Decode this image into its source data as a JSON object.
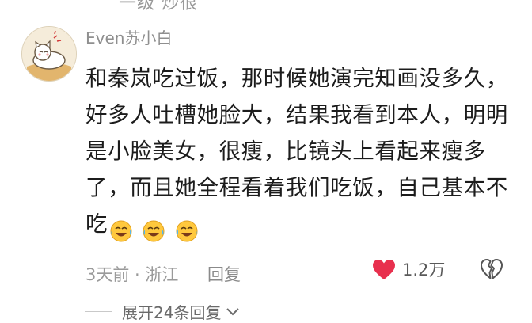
{
  "previous_reply_fragment": "一级 炒很",
  "comment": {
    "username": "Even苏小白",
    "text": "和秦岚吃过饭，那时候她演完知画没多久，好多人吐槽她脸大，结果我看到本人，明明是小脸美女，很瘦，比镜头上看起来瘦多了，而且她全程看着我们吃饭，自己基本不吃",
    "emoji_count": 3,
    "emoji_name": "laughing-crying",
    "time_location": "3天前 · 浙江",
    "reply_label": "回复",
    "likes": "1.2万",
    "expand_replies_label": "展开24条回复"
  },
  "colors": {
    "heart": "#e8304e",
    "meta": "#9a9a9a",
    "text": "#1c1c1c"
  },
  "icons": {
    "like": "heart-icon",
    "dislike": "broken-heart-icon",
    "expand": "chevron-down-icon"
  }
}
